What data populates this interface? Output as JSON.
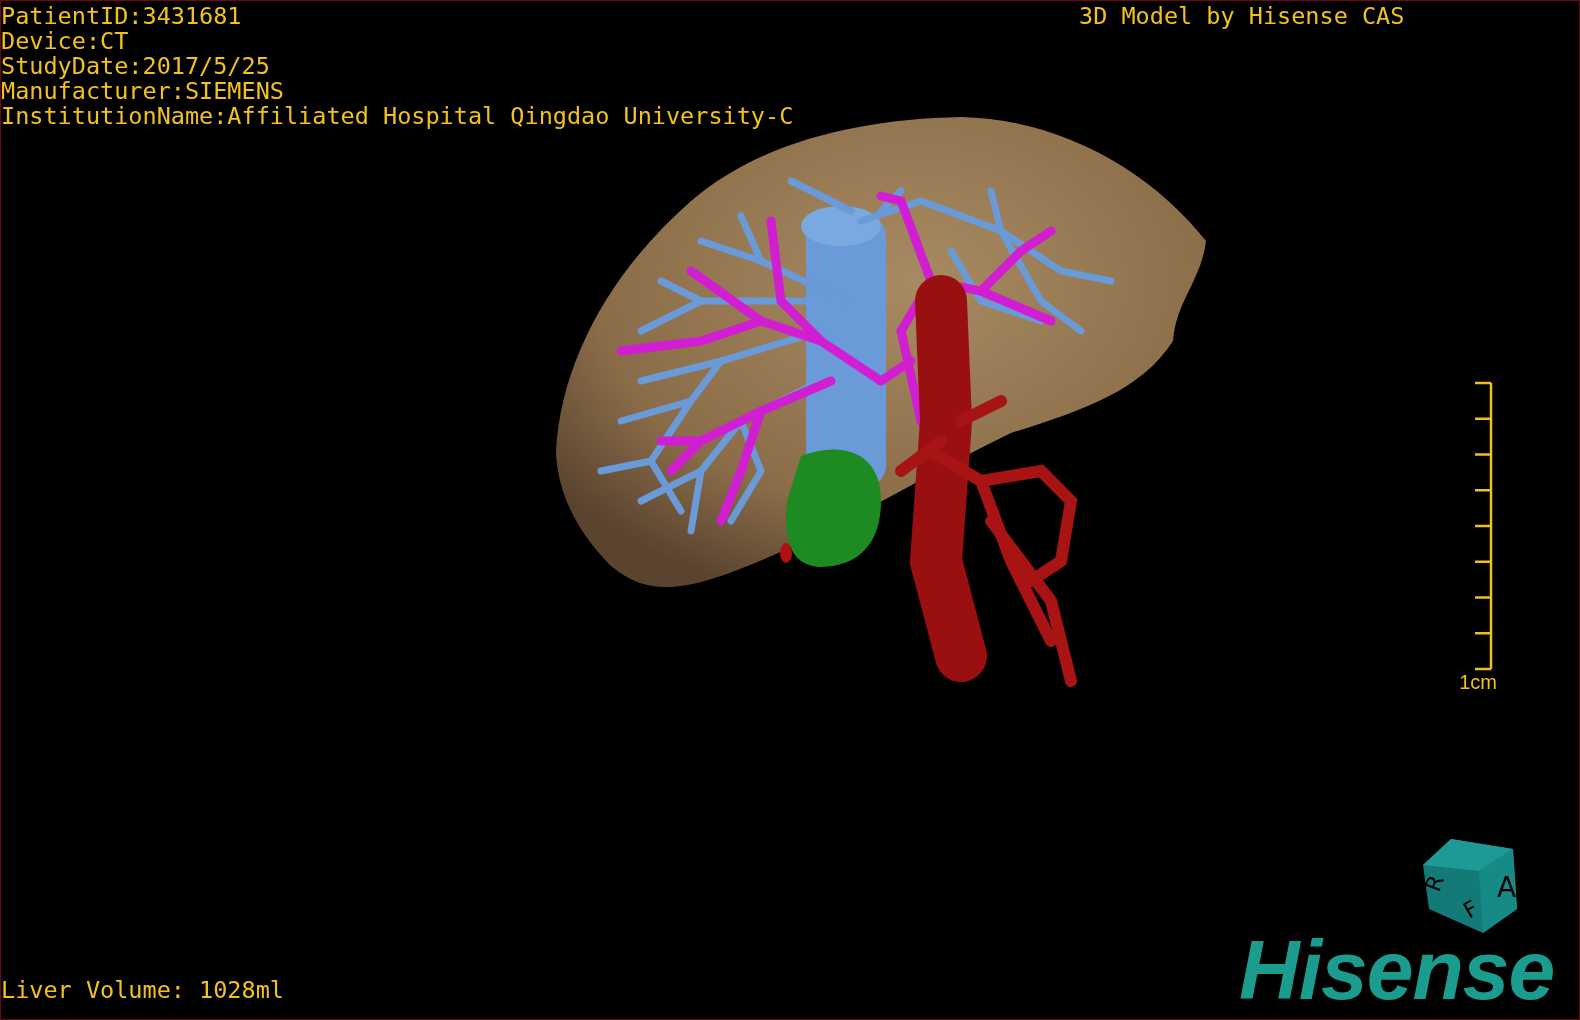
{
  "patient_info": [
    "PatientID:3431681",
    "Device:CT",
    "StudyDate:2017/5/25",
    "Manufacturer:SIEMENS",
    "InstitutionName:Affiliated Hospital Qingdao University-C"
  ],
  "model_title": "3D Model by Hisense CAS",
  "scale_bar": {
    "label": "1cm"
  },
  "orientation_cube": {
    "labels": [
      "A",
      "R",
      "F"
    ]
  },
  "logo": "Hisense",
  "liver_volume": "Liver Volume: 1028ml"
}
